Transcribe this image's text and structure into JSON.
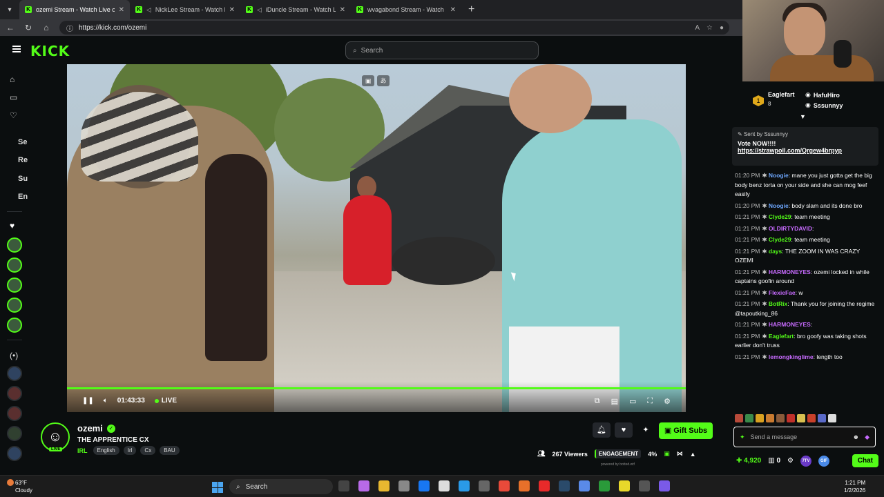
{
  "browser": {
    "tabs": [
      {
        "title": "ozemi Stream - Watch Live on Kick",
        "active": true
      },
      {
        "title": "NickLee Stream - Watch Live on Kick",
        "active": false
      },
      {
        "title": "iDuncle Stream - Watch Live on Kick",
        "active": false
      },
      {
        "title": "wvagabond Stream - Watch Live on Kick",
        "active": false
      }
    ],
    "url": "https://kick.com/ozemi"
  },
  "kick": {
    "logo": "KICK",
    "search_placeholder": "Search",
    "sidebar_labels": [
      "Se",
      "Re",
      "Su",
      "En"
    ]
  },
  "player": {
    "time": "01:43:33",
    "live_label": "LIVE",
    "progress": 1.0
  },
  "stream": {
    "channel": "ozemi",
    "live_badge": "LIVE",
    "title": "THE APPRENTICE CX",
    "category": "IRL",
    "tags": [
      "English",
      "Irl",
      "Cx",
      "BAU"
    ],
    "gift_label": "Gift Subs",
    "viewers": "267",
    "viewers_label": "Viewers",
    "engagement_label": "ENGAGEMENT",
    "engagement_value": "4%",
    "powered": "powered by botted.wtf"
  },
  "chat": {
    "leaderboard": {
      "first": {
        "name": "Eaglefart",
        "count": "8"
      },
      "second": {
        "name": "HafuHiro"
      },
      "third": {
        "name": "Sssunnyy"
      }
    },
    "pinned": {
      "sent_by_label": "Sent by",
      "sender": "Sssunnyy",
      "message": "Vote NOW!!!!",
      "link": "https://strawpoll.com/Qrgew4brpyp"
    },
    "messages": [
      {
        "time": "01:20 PM",
        "user": "Noogie",
        "color": "#6ea8ff",
        "text": "mane you just gotta get the big body benz torta on your side and she can mog feef easily"
      },
      {
        "time": "01:20 PM",
        "user": "Noogie",
        "color": "#6ea8ff",
        "text": "body slam and its done bro"
      },
      {
        "time": "01:21 PM",
        "user": "Clyde29",
        "color": "#53fc18",
        "text": "team meeting"
      },
      {
        "time": "01:21 PM",
        "user": "OLDIRTYDAVID",
        "color": "#c86bff",
        "text": ""
      },
      {
        "time": "01:21 PM",
        "user": "Clyde29",
        "color": "#53fc18",
        "text": "team meeting"
      },
      {
        "time": "01:21 PM",
        "user": "days",
        "color": "#53fc18",
        "text": "THE ZOOM IN WAS CRAZY OZEMI"
      },
      {
        "time": "01:21 PM",
        "user": "HARMONEYES",
        "color": "#c86bff",
        "text": "ozemi locked in while captains goofin around"
      },
      {
        "time": "01:21 PM",
        "user": "FlexieFae",
        "color": "#c86bff",
        "text": "w"
      },
      {
        "time": "01:21 PM",
        "user": "BotRix",
        "color": "#53fc18",
        "text": "Thank you for joining the regime @tapoutking_86"
      },
      {
        "time": "01:21 PM",
        "user": "HARMONEYES",
        "color": "#c86bff",
        "text": ""
      },
      {
        "time": "01:21 PM",
        "user": "Eaglefart",
        "color": "#53fc18",
        "text": "bro goofy was taking shots earlier don't truss"
      },
      {
        "time": "01:21 PM",
        "user": "lemongkinglime",
        "color": "#c86bff",
        "text": "length too"
      }
    ],
    "input_placeholder": "Send a message",
    "points": "4,920",
    "subs_count": "0",
    "chat_button": "Chat"
  },
  "taskbar": {
    "temp": "63°F",
    "condition": "Cloudy",
    "search": "Search",
    "time": "1:21 PM",
    "date": "1/2/2026"
  }
}
